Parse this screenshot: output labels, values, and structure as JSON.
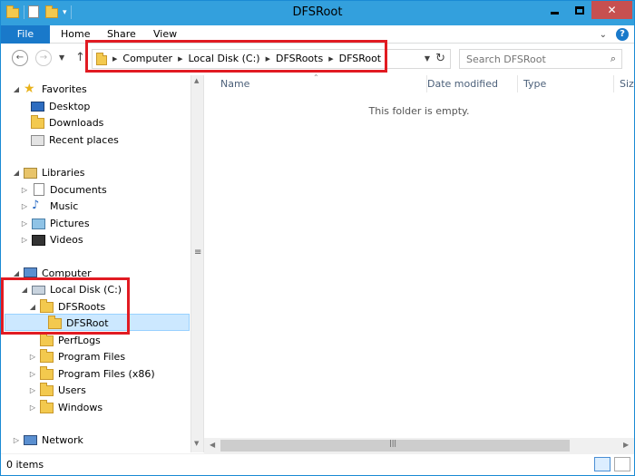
{
  "window": {
    "title": "DFSRoot",
    "controls": {
      "minimize": "",
      "maximize": "",
      "close": "✕"
    }
  },
  "ribbon": {
    "tabs": [
      "File",
      "Home",
      "Share",
      "View"
    ],
    "help": "?"
  },
  "navigation": {
    "address": {
      "crumbs": [
        "Computer",
        "Local Disk (C:)",
        "DFSRoots",
        "DFSRoot"
      ]
    },
    "search": {
      "placeholder": "Search DFSRoot"
    }
  },
  "tree": {
    "favorites": {
      "label": "Favorites",
      "items": [
        "Desktop",
        "Downloads",
        "Recent places"
      ]
    },
    "libraries": {
      "label": "Libraries",
      "items": [
        "Documents",
        "Music",
        "Pictures",
        "Videos"
      ]
    },
    "computer": {
      "label": "Computer",
      "disk": "Local Disk (C:)",
      "folders": [
        "DFSRoots",
        "DFSRoot",
        "PerfLogs",
        "Program Files",
        "Program Files (x86)",
        "Users",
        "Windows"
      ]
    },
    "network": {
      "label": "Network"
    }
  },
  "content": {
    "columns": [
      "Name",
      "Date modified",
      "Type",
      "Size"
    ],
    "empty_message": "This folder is empty."
  },
  "status": {
    "items_count": "0 items"
  },
  "colors": {
    "titlebar": "#33a0dd",
    "file_tab": "#1979ca",
    "highlight_box": "#e11b22",
    "selected_row": "#cce8ff"
  }
}
